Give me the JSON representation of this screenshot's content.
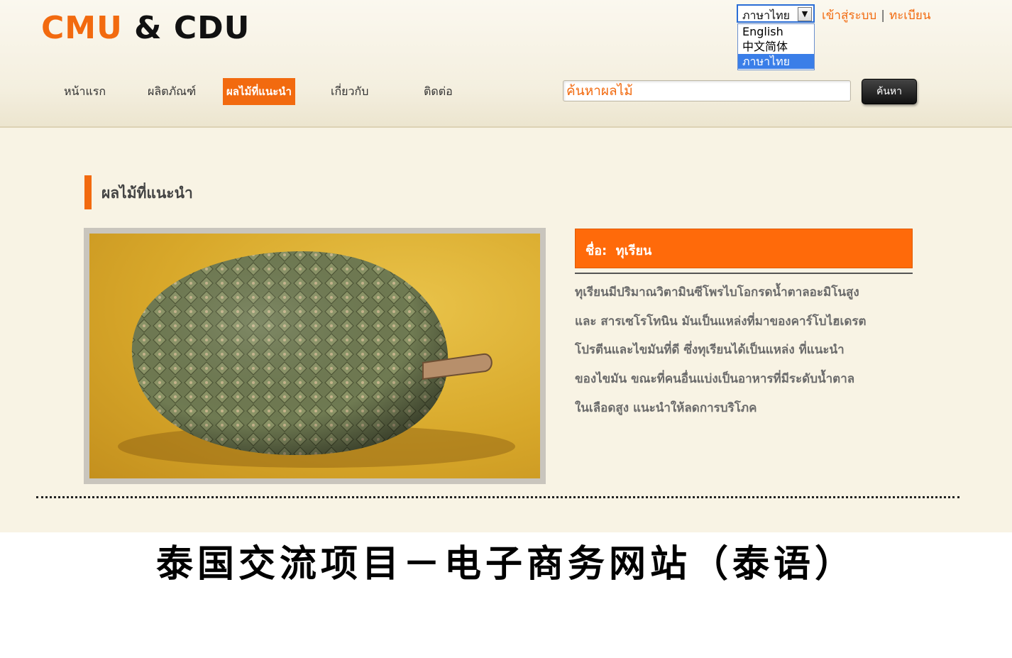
{
  "logo": {
    "part1": "CMU",
    "amp": "&",
    "part2": "CDU"
  },
  "language": {
    "selected": "ภาษาไทย",
    "options": [
      "English",
      "中文简体",
      "ภาษาไทย"
    ]
  },
  "auth": {
    "login": "เข้าสู่ระบบ",
    "separator": "|",
    "register": "ทะเบียน"
  },
  "nav": {
    "items": [
      {
        "label": "หน้าแรก"
      },
      {
        "label": "ผลิตภัณฑ์"
      },
      {
        "label": "ผลไม้ที่แนะนำ"
      },
      {
        "label": "เกี่ยวกับ"
      },
      {
        "label": "ติดต่อ"
      }
    ],
    "active_index": 2
  },
  "search": {
    "placeholder": "ค้นหาผลไม้",
    "button_label": "ค้นหา"
  },
  "section": {
    "title": "ผลไม้ที่แนะนำ"
  },
  "fruit": {
    "name_label": "ชื่อ:",
    "name": "ทุเรียน",
    "description_lines": [
      "ทุเรียนมีปริมาณวิตามินซีโพรไบโอกรดน้ำตาลอะมิโนสูง",
      "และ สารเซโรโทนิน มันเป็นแหล่งที่มาของคาร์โบไฮเดรต",
      "โปรตีนและไขมันที่ดี ซึ่งทุเรียนได้เป็นแหล่ง ที่แนะนำ",
      "ของไขมัน ขณะที่คนอื่นแบ่งเป็นอาหารที่มีระดับน้ำตาล",
      "ในเลือดสูง แนะนำให้ลดการบริโภค"
    ]
  },
  "caption": "泰国交流项目－电子商务网站（泰语）",
  "colors": {
    "accent": "#f26a0f",
    "background": "#f8f3e4"
  }
}
